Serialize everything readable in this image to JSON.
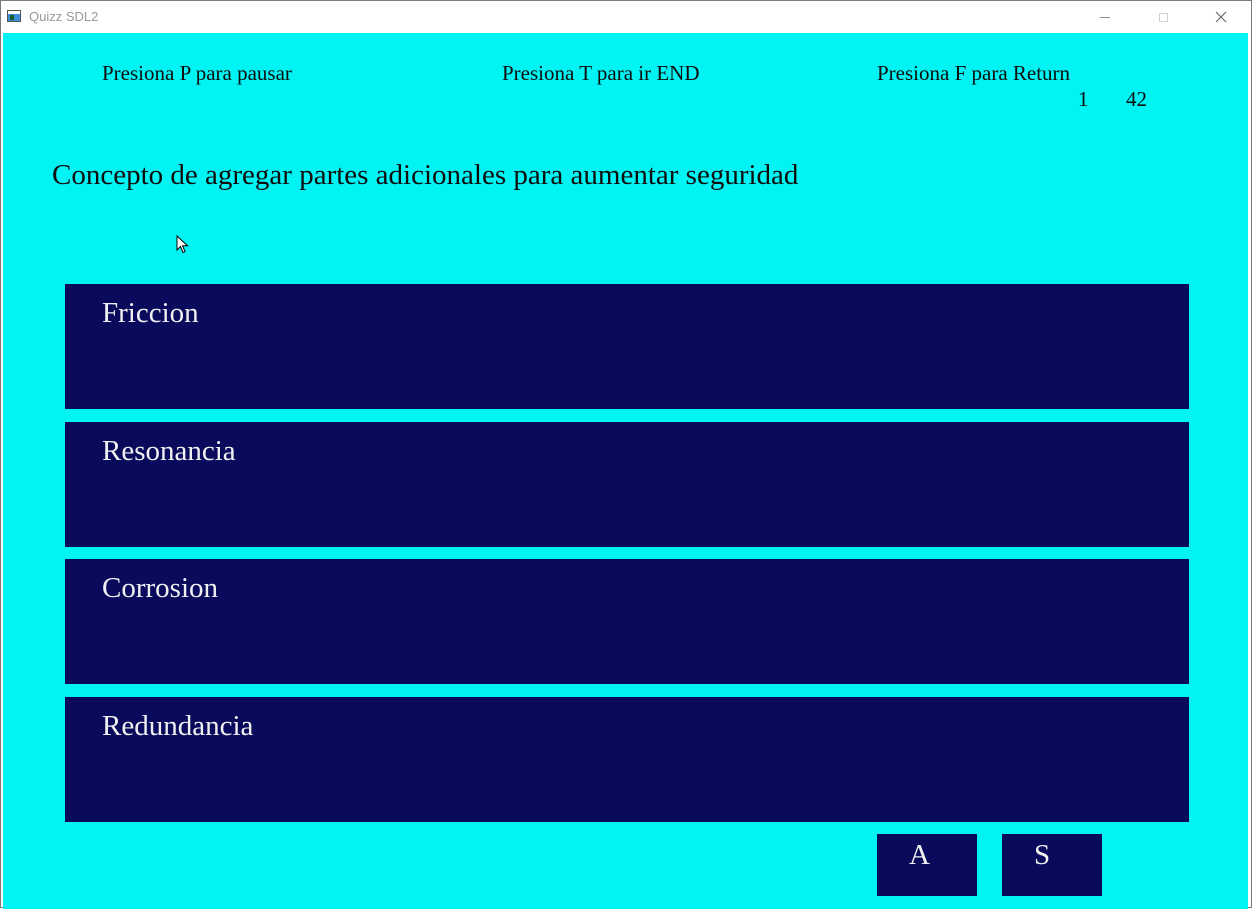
{
  "window": {
    "title": "Quizz SDL2",
    "icon": "app-window-icon"
  },
  "titlebar_controls": {
    "minimize_icon": "minimize-icon",
    "maximize_icon": "maximize-icon",
    "close_icon": "close-icon"
  },
  "hints": {
    "pause": "Presiona P para pausar",
    "end": "Presiona T para ir END",
    "return": "Presiona F para Return"
  },
  "counters": {
    "first": "1",
    "second": "42"
  },
  "question": "Concepto de agregar partes adicionales para aumentar seguridad",
  "options": [
    {
      "label": "Friccion"
    },
    {
      "label": "Resonancia"
    },
    {
      "label": "Corrosion"
    },
    {
      "label": "Redundancia"
    }
  ],
  "keys": {
    "a": "A",
    "s": "S"
  },
  "colors": {
    "background": "#00f4f4",
    "option_fill": "#0a0a5c",
    "option_text": "#f0f0f0",
    "text": "#0d0d0d"
  }
}
